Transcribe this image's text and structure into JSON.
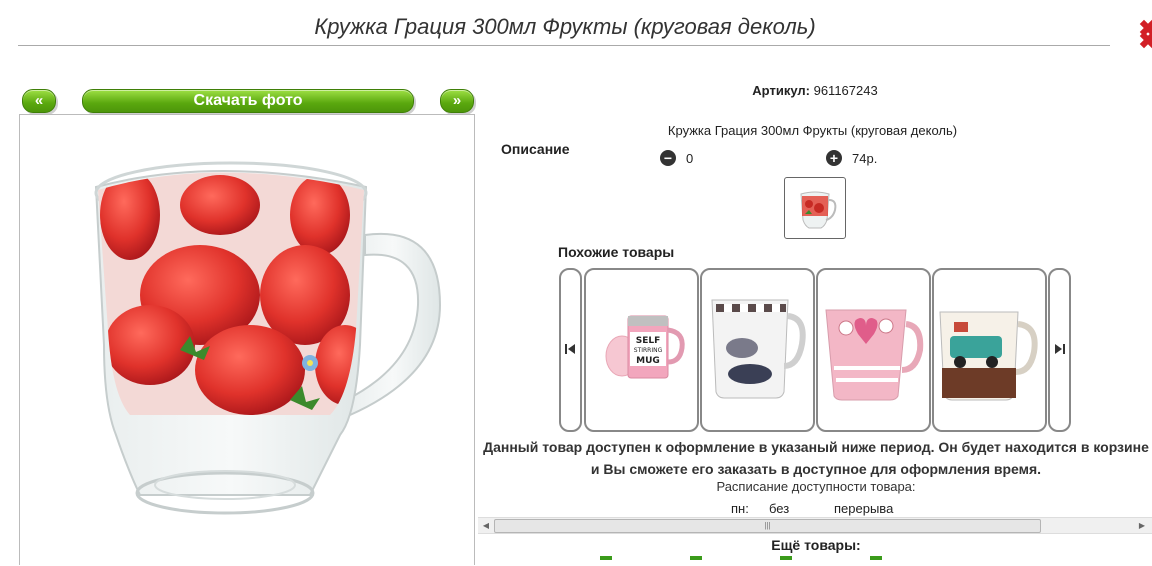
{
  "page": {
    "title": "Кружка Грация 300мл Фрукты (круговая деколь)"
  },
  "gallery": {
    "prev_label": "«",
    "download_label": "Скачать фото",
    "next_label": "»"
  },
  "product": {
    "sku_label": "Артикул:",
    "sku_value": "961167243",
    "description_label": "Описание",
    "description_text": "Кружка Грация 300мл Фрукты (круговая деколь)",
    "quantity": "0",
    "price": "74р."
  },
  "similar": {
    "label": "Похожие товары",
    "items": [
      {
        "name": "self-stirring-mug"
      },
      {
        "name": "fashion-mug"
      },
      {
        "name": "heart-pattern-mug"
      },
      {
        "name": "retro-car-mug"
      }
    ]
  },
  "availability": {
    "notice": "Данный товар доступен к оформление в указаный ниже период. Он будет находится в корзине и Вы сможете его заказать в доступное для оформления время.",
    "schedule_label": "Расписание доступности товара:",
    "day": "пн:",
    "without": "без",
    "break": "перерыва"
  },
  "footer": {
    "more_label": "Ещё товары:"
  },
  "colors": {
    "accent_green": "#5aa80e",
    "close_red": "#d21f26"
  }
}
